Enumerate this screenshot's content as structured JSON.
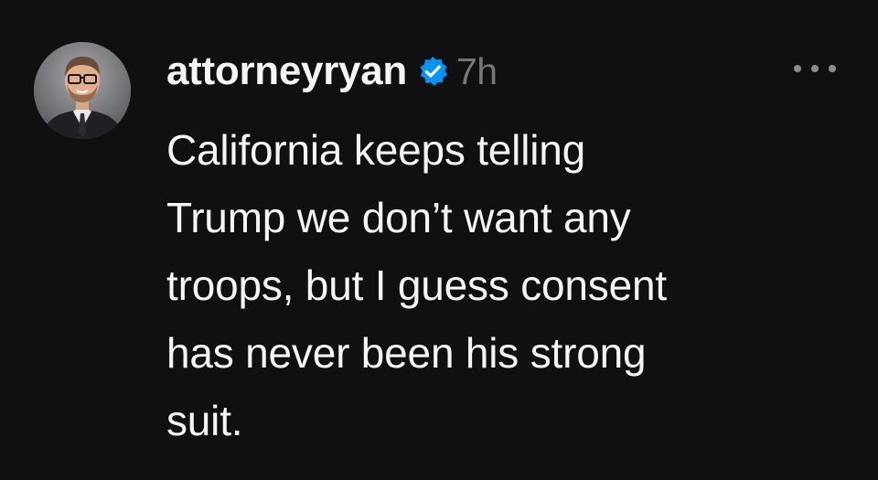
{
  "post": {
    "username": "attorneyryan",
    "verified": true,
    "timestamp": "7h",
    "text_lines": [
      "California keeps telling",
      "Trump we don’t want any",
      "troops, but I guess consent",
      "has never been his strong",
      "suit."
    ]
  },
  "colors": {
    "background": "#101010",
    "text": "#f3f5f7",
    "muted": "#777777",
    "verified_badge": "#0095f6"
  },
  "icons": {
    "avatar": "profile-photo",
    "verified": "verified-badge-icon",
    "more": "more-options-icon"
  }
}
